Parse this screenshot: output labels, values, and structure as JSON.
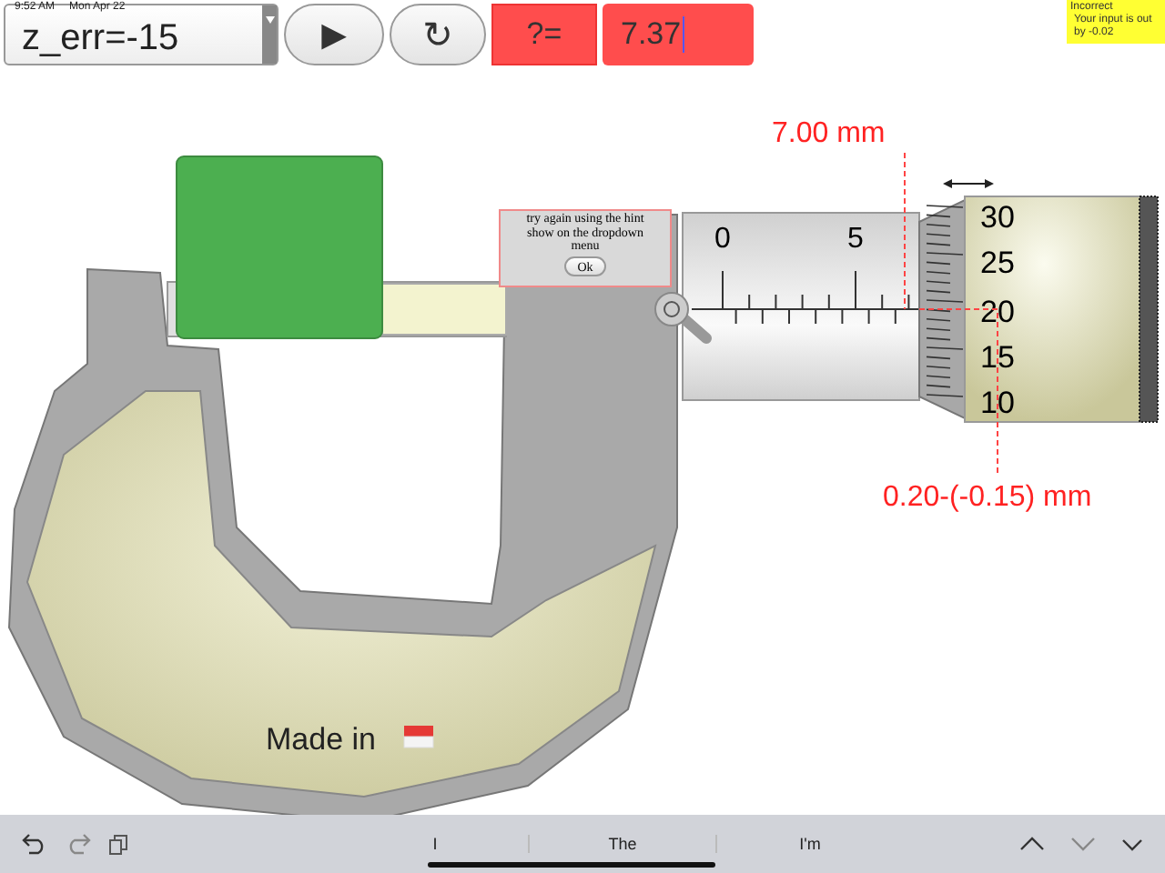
{
  "status_bar": {
    "time": "9:52 AM",
    "date": "Mon Apr 22"
  },
  "toolbar": {
    "dropdown": {
      "value": "z_err=-15"
    },
    "play_button": "▶",
    "reset_button": "↻",
    "question_label": "?=",
    "answer": {
      "value": "7.37"
    }
  },
  "feedback": {
    "title": "Incorrect",
    "message": "Your input is out by -0.02"
  },
  "micrometer": {
    "sleeve_labels": [
      "0",
      "5"
    ],
    "thimble_labels": [
      "30",
      "25",
      "20",
      "15",
      "10"
    ],
    "main_reading": "7.00 mm",
    "thimble_reading": "0.20-(-0.15) mm",
    "made_in": "Made in"
  },
  "hint": {
    "message": "try again using the hint show on the dropdown menu",
    "button": "Ok"
  },
  "keyboard_bar": {
    "suggestions": [
      "I",
      "The",
      "I'm"
    ]
  }
}
